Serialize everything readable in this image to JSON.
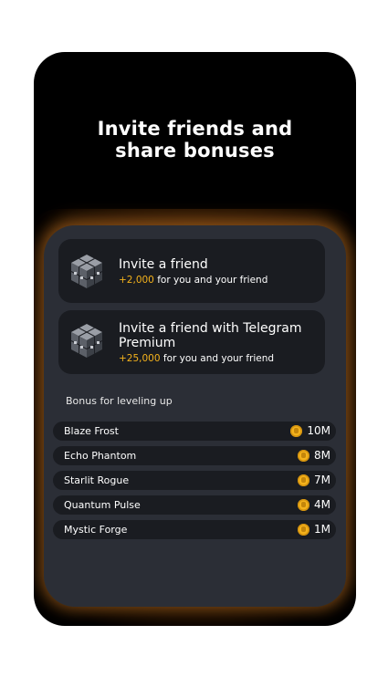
{
  "header": {
    "title_line1": "Invite friends and",
    "title_line2": "share bonuses"
  },
  "invite_cards": [
    {
      "icon": "cube-icon",
      "title": "Invite a friend",
      "amount": "+2,000",
      "description": "for you and your friend"
    },
    {
      "icon": "cube-icon",
      "title": "Invite a friend with Telegram Premium",
      "amount": "+25,000",
      "description": "for you and your friend"
    }
  ],
  "levels": {
    "label": "Bonus for leveling up",
    "items": [
      {
        "name": "Blaze Frost",
        "icon": "coin-icon",
        "value": "10M"
      },
      {
        "name": "Echo Phantom",
        "icon": "coin-icon",
        "value": "8M"
      },
      {
        "name": "Starlit Rogue",
        "icon": "coin-icon",
        "value": "7M"
      },
      {
        "name": "Quantum Pulse",
        "icon": "coin-icon",
        "value": "4M"
      },
      {
        "name": "Mystic Forge",
        "icon": "coin-icon",
        "value": "1M"
      }
    ]
  },
  "colors": {
    "accent": "#f4b21c",
    "panel": "#2b2e36",
    "card": "#1a1c21",
    "glow": "#c8782a"
  }
}
